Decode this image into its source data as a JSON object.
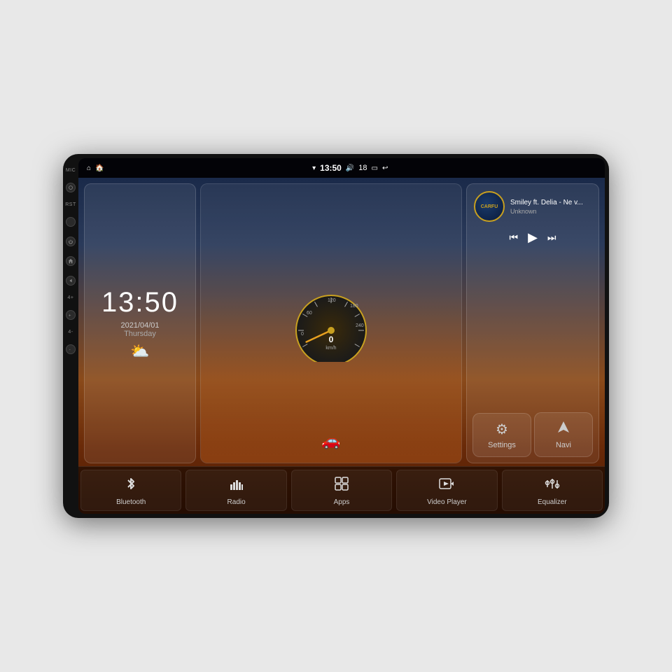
{
  "device": {
    "background_color": "#111"
  },
  "status_bar": {
    "left_icons": [
      "home",
      "house-alt"
    ],
    "time": "13:50",
    "volume": "18",
    "wifi_icon": "▾",
    "battery_icon": "▭",
    "back_icon": "↩"
  },
  "clock_widget": {
    "time": "13:50",
    "date": "2021/04/01",
    "day": "Thursday",
    "weather": "⛅"
  },
  "speedometer": {
    "value": "0",
    "unit": "km/h",
    "max": "240"
  },
  "music": {
    "logo_text": "CARFU",
    "title": "Smiley ft. Delia - Ne v...",
    "artist": "Unknown",
    "prev": "⏮",
    "play": "▶",
    "next": "⏭"
  },
  "settings_buttons": [
    {
      "id": "settings",
      "icon": "⚙",
      "label": "Settings"
    },
    {
      "id": "navi",
      "icon": "◭",
      "label": "Navi"
    }
  ],
  "app_bar": [
    {
      "id": "bluetooth",
      "icon": "bluetooth",
      "label": "Bluetooth"
    },
    {
      "id": "radio",
      "icon": "radio",
      "label": "Radio"
    },
    {
      "id": "apps",
      "icon": "apps",
      "label": "Apps"
    },
    {
      "id": "video-player",
      "icon": "video",
      "label": "Video Player"
    },
    {
      "id": "equalizer",
      "icon": "equalizer",
      "label": "Equalizer"
    }
  ],
  "side_buttons": [
    {
      "id": "mic",
      "label": "MIC"
    },
    {
      "id": "rst",
      "label": "RST"
    },
    {
      "id": "power",
      "label": ""
    },
    {
      "id": "home",
      "label": ""
    },
    {
      "id": "back",
      "label": ""
    },
    {
      "id": "vol-up",
      "label": "4+"
    },
    {
      "id": "vol-down",
      "label": "4-"
    }
  ]
}
